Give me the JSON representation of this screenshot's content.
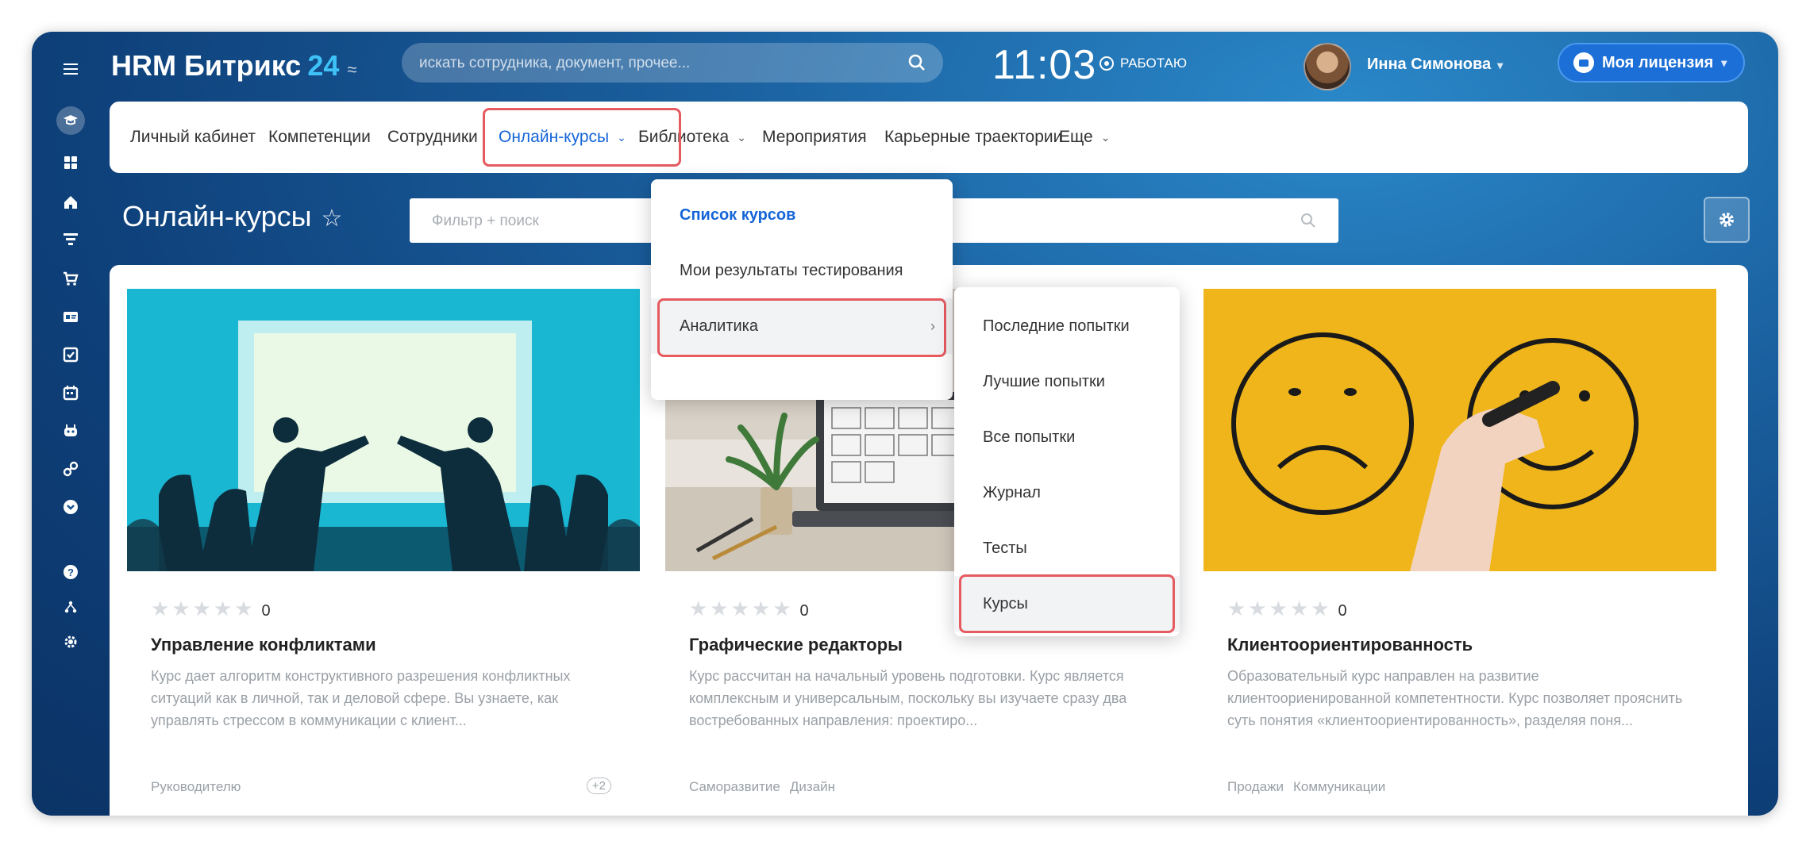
{
  "app": {
    "name": "HRM Битрикс",
    "name_suffix": "24",
    "switch_glyph": "≈"
  },
  "search": {
    "placeholder": "искать сотрудника, документ, прочее..."
  },
  "status": {
    "time": "11:03",
    "work_label": "РАБОТАЮ"
  },
  "user": {
    "name": "Инна Симонова",
    "caret": "▾"
  },
  "license": {
    "label": "Моя лицензия",
    "caret": "▾"
  },
  "nav": {
    "items": [
      {
        "label": "Личный кабинет"
      },
      {
        "label": "Компетенции"
      },
      {
        "label": "Сотрудники"
      },
      {
        "label": "Онлайн-курсы",
        "chevron": "⌄"
      },
      {
        "label": "Библиотека",
        "chevron": "⌄"
      },
      {
        "label": "Мероприятия"
      },
      {
        "label": "Карьерные траектории"
      },
      {
        "label": "Еще",
        "chevron": "⌄"
      }
    ]
  },
  "page": {
    "title": "Онлайн-курсы",
    "star": "☆",
    "filter_placeholder": "Фильтр + поиск"
  },
  "menu": {
    "items": [
      {
        "label": "Список курсов"
      },
      {
        "label": "Мои результаты тестирования"
      },
      {
        "label": "Аналитика",
        "arrow": "›"
      }
    ]
  },
  "submenu": {
    "items": [
      {
        "label": "Последние попытки"
      },
      {
        "label": "Лучшие попытки"
      },
      {
        "label": "Все попытки"
      },
      {
        "label": "Журнал"
      },
      {
        "label": "Тесты"
      },
      {
        "label": "Курсы"
      }
    ]
  },
  "cards": [
    {
      "stars": "★★★★★",
      "rating": "0",
      "title": "Управление конфликтами",
      "description": "Курс дает алгоритм конструктивного разрешения конфликтных ситуаций как в личной, так и деловой сфере. Вы узнаете, как управлять стрессом в коммуникации с клиент...",
      "tags": [
        "Руководителю"
      ],
      "extra": "+2"
    },
    {
      "stars": "★★★★★",
      "rating": "0",
      "title": "Графические редакторы",
      "description": "Курс рассчитан на начальный уровень подготовки. Курс является комплексным и универсальным, поскольку вы изучаете сразу два востребованных направления: проектиро...",
      "tags": [
        "Саморазвитие",
        "Дизайн"
      ]
    },
    {
      "stars": "★★★★★",
      "rating": "0",
      "title": "Клиентоориентированность",
      "description": "Образовательный курс направлен на развитие клиентоориенированной компетентности. Курс позволяет прояснить суть понятия «клиентоориентированность», разделяя поня...",
      "tags": [
        "Продажи",
        "Коммуникации"
      ]
    }
  ],
  "colors": {
    "accent": "#1565d8",
    "highlight": "#e55b60",
    "bg": "#14518f",
    "logo24": "#3ec2f7"
  }
}
